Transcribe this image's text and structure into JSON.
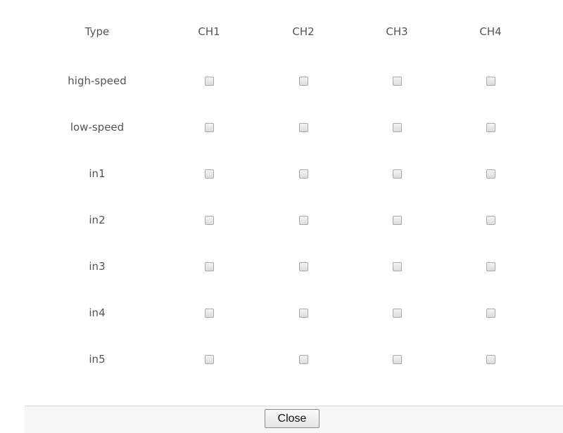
{
  "table": {
    "type_header": "Type",
    "channels": [
      "CH1",
      "CH2",
      "CH3",
      "CH4"
    ],
    "rows": [
      {
        "label": "high-speed",
        "checked": [
          false,
          false,
          false,
          false
        ]
      },
      {
        "label": "low-speed",
        "checked": [
          false,
          false,
          false,
          false
        ]
      },
      {
        "label": "in1",
        "checked": [
          false,
          false,
          false,
          false
        ]
      },
      {
        "label": "in2",
        "checked": [
          false,
          false,
          false,
          false
        ]
      },
      {
        "label": "in3",
        "checked": [
          false,
          false,
          false,
          false
        ]
      },
      {
        "label": "in4",
        "checked": [
          false,
          false,
          false,
          false
        ]
      },
      {
        "label": "in5",
        "checked": [
          false,
          false,
          false,
          false
        ]
      }
    ]
  },
  "footer": {
    "close_label": "Close"
  }
}
